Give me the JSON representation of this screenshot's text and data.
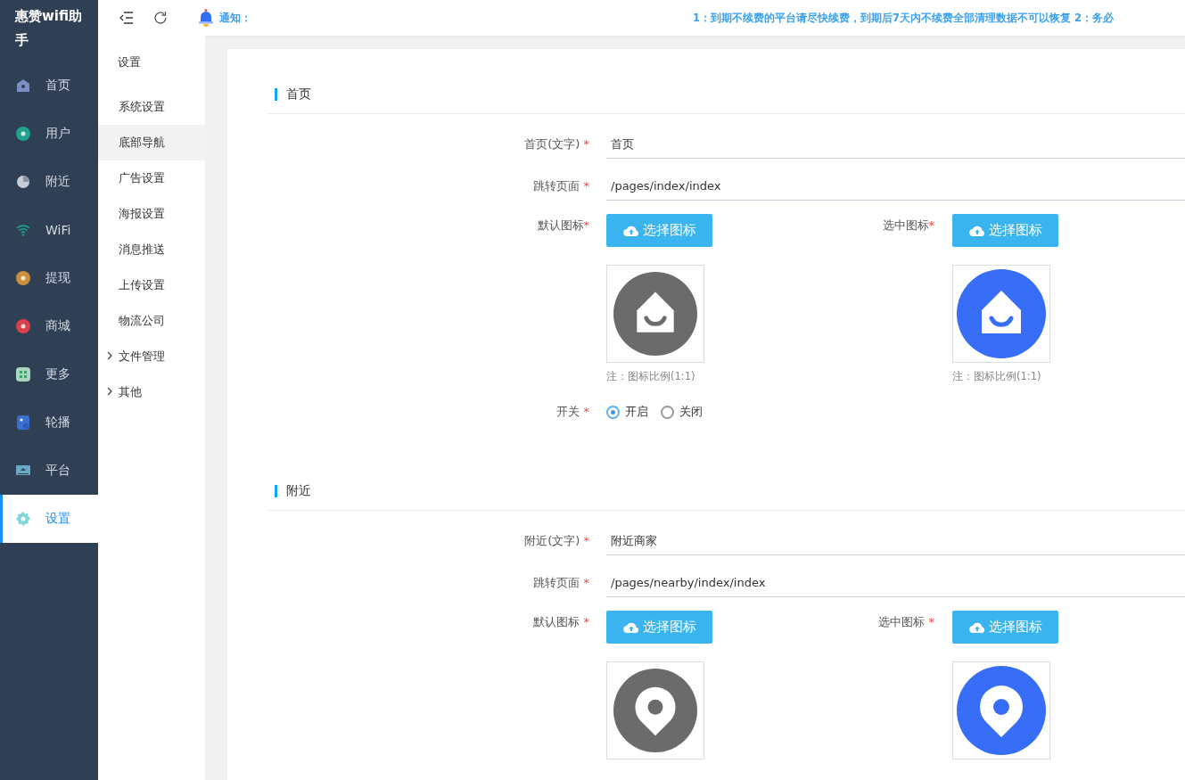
{
  "app_title": "惠赞wifi助手",
  "sidebar": {
    "items": [
      {
        "label": "首页",
        "color": "#7b8fc6",
        "selected": false
      },
      {
        "label": "用户",
        "color": "#1fa38a",
        "selected": false
      },
      {
        "label": "附近",
        "color": "#c8ccd4",
        "selected": false
      },
      {
        "label": "WiFi",
        "color": "#1fa38a",
        "selected": false
      },
      {
        "label": "提现",
        "color": "#c8923a",
        "selected": false
      },
      {
        "label": "商城",
        "color": "#d8404a",
        "selected": false
      },
      {
        "label": "更多",
        "color": "#a9d6c0",
        "selected": false
      },
      {
        "label": "轮播",
        "color": "#3a6fd0",
        "selected": false
      },
      {
        "label": "平台",
        "color": "#6aa8c8",
        "selected": false
      },
      {
        "label": "设置",
        "color": "#7fd6d8",
        "selected": true
      }
    ]
  },
  "submenu": {
    "title": "设置",
    "items": [
      {
        "label": "系统设置",
        "selected": false
      },
      {
        "label": "底部导航",
        "selected": true
      },
      {
        "label": "广告设置",
        "selected": false
      },
      {
        "label": "海报设置",
        "selected": false
      },
      {
        "label": "消息推送",
        "selected": false
      },
      {
        "label": "上传设置",
        "selected": false
      },
      {
        "label": "物流公司",
        "selected": false
      },
      {
        "label": "文件管理",
        "selected": false,
        "expanded": false
      },
      {
        "label": "其他",
        "selected": false,
        "expanded": false
      }
    ]
  },
  "topbar": {
    "notice_label": "通知：",
    "notice_text": "1：到期不续费的平台请尽快续费，到期后7天内不续费全部清理数据不可以恢复 2：务必"
  },
  "sections": [
    {
      "title": "首页",
      "text_label": "首页(文字)",
      "text_mark": "*",
      "text_value": "首页",
      "page_label": "跳转页面",
      "page_mark": "*",
      "page_value": "/pages/index/index",
      "default_icon_label": "默认图标",
      "default_mark": "*",
      "selected_icon_label": "选中图标",
      "selected_mark": "*",
      "default_button": "选择图标",
      "selected_button": "选择图标",
      "default_note": "注：图标比例(1:1)",
      "selected_note": "注：图标比例(1:1)",
      "switch": {
        "label": "开关",
        "mark": "*",
        "options": [
          {
            "label": "开启",
            "selected": true
          },
          {
            "label": "关闭",
            "selected": false
          }
        ]
      }
    },
    {
      "title": "附近",
      "text_label": "附近(文字)",
      "text_mark": "*",
      "text_value": "附近商家",
      "page_label": "跳转页面",
      "page_mark": "*",
      "page_value": "/pages/nearby/index/index",
      "default_icon_label": "默认图标",
      "default_mark": "*",
      "selected_icon_label": "选中图标",
      "selected_mark": "*",
      "default_button": "选择图标",
      "selected_button": "选择图标"
    }
  ]
}
